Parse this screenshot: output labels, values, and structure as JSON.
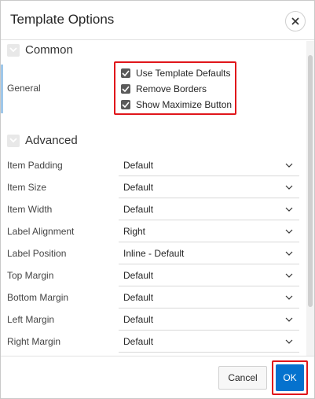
{
  "dialog": {
    "title": "Template Options",
    "close_icon": "close-icon"
  },
  "sections": {
    "common": {
      "title": "Common",
      "icon": "chevron-down-icon"
    },
    "advanced": {
      "title": "Advanced",
      "icon": "chevron-down-icon"
    }
  },
  "general": {
    "label": "General",
    "options": [
      {
        "label": "Use Template Defaults",
        "checked": true
      },
      {
        "label": "Remove Borders",
        "checked": true
      },
      {
        "label": "Show Maximize Button",
        "checked": true
      }
    ]
  },
  "advanced_fields": [
    {
      "label": "Item Padding",
      "value": "Default"
    },
    {
      "label": "Item Size",
      "value": "Default"
    },
    {
      "label": "Item Width",
      "value": "Default"
    },
    {
      "label": "Label Alignment",
      "value": "Right"
    },
    {
      "label": "Label Position",
      "value": "Inline - Default"
    },
    {
      "label": "Top Margin",
      "value": "Default"
    },
    {
      "label": "Bottom Margin",
      "value": "Default"
    },
    {
      "label": "Left Margin",
      "value": "Default"
    },
    {
      "label": "Right Margin",
      "value": "Default"
    }
  ],
  "footer": {
    "cancel_label": "Cancel",
    "ok_label": "OK"
  },
  "colors": {
    "accent": "#0572ce",
    "highlight": "#e0161b"
  }
}
